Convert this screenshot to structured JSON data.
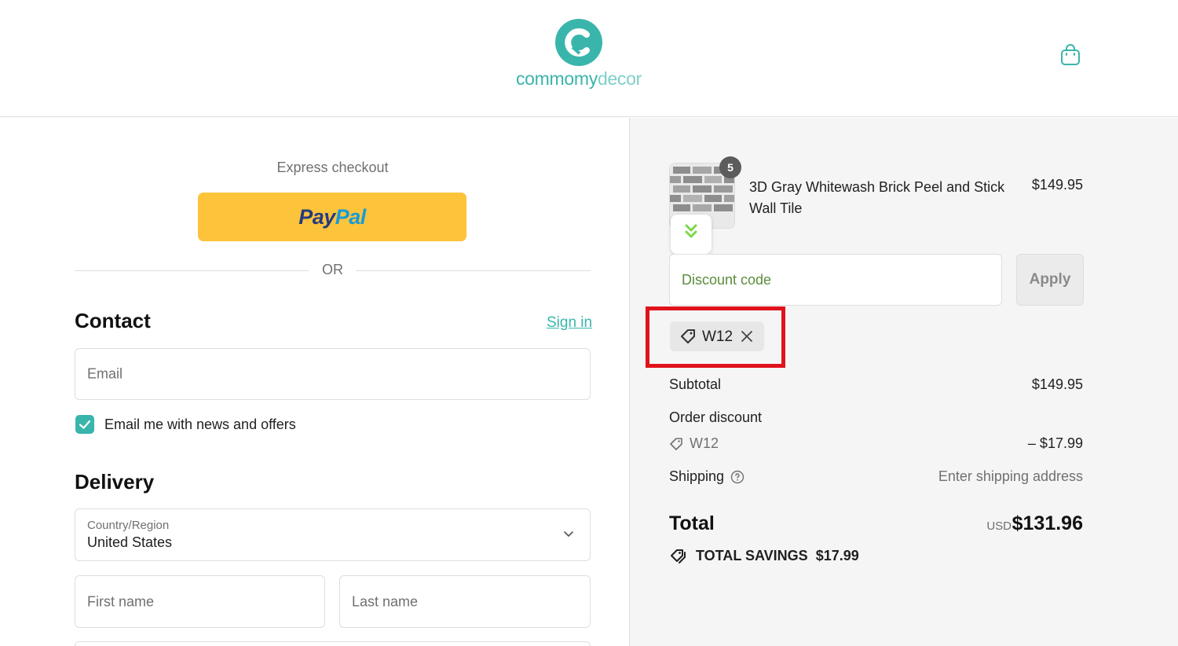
{
  "header": {
    "brand_part1": "commomy",
    "brand_part2": "decor",
    "cart_icon": "shopping-bag-icon"
  },
  "express": {
    "label": "Express checkout",
    "paypal_part1": "Pay",
    "paypal_part2": "Pal",
    "or_text": "OR"
  },
  "contact": {
    "title": "Contact",
    "signin": "Sign in",
    "email_placeholder": "Email",
    "newsletter_label": "Email me with news and offers",
    "newsletter_checked": true
  },
  "delivery": {
    "title": "Delivery",
    "country_label": "Country/Region",
    "country_value": "United States",
    "first_name_placeholder": "First name",
    "last_name_placeholder": "Last name"
  },
  "order": {
    "item": {
      "quantity": "5",
      "name": "3D Gray Whitewash Brick Peel and Stick Wall Tile",
      "price": "$149.95"
    },
    "discount_placeholder": "Discount code",
    "apply_label": "Apply",
    "applied_code": "W12",
    "subtotal_label": "Subtotal",
    "subtotal_value": "$149.95",
    "order_discount_label": "Order discount",
    "discount_code": "W12",
    "discount_value": "– $17.99",
    "shipping_label": "Shipping",
    "shipping_value": "Enter shipping address",
    "total_label": "Total",
    "currency": "USD",
    "total_value": "$131.96",
    "savings_label": "TOTAL SAVINGS",
    "savings_value": "$17.99"
  },
  "colors": {
    "accent": "#3ab5ac",
    "paypal_yellow": "#fdc33b",
    "highlight": "#e0121b"
  }
}
